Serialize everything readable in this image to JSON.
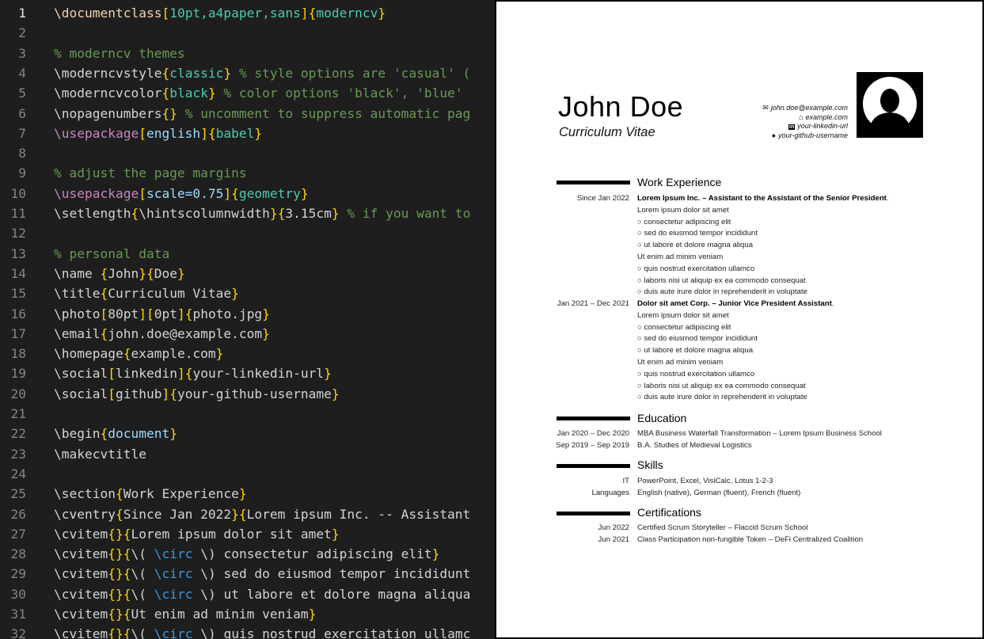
{
  "editor": {
    "lines": [
      {
        "n": "1",
        "active": true,
        "tokens": [
          [
            "tok-cmd",
            "\\documentclass"
          ],
          [
            "tok-brk",
            "["
          ],
          [
            "tok-opt",
            "10pt,a4paper,sans"
          ],
          [
            "tok-brk",
            "]"
          ],
          [
            "tok-brace",
            "{"
          ],
          [
            "tok-opt",
            "moderncv"
          ],
          [
            "tok-brace",
            "}"
          ]
        ]
      },
      {
        "n": "2",
        "tokens": []
      },
      {
        "n": "3",
        "tokens": [
          [
            "tok-com",
            "% moderncv themes"
          ]
        ]
      },
      {
        "n": "4",
        "tokens": [
          [
            "tok-txt",
            "\\moderncvstyle"
          ],
          [
            "tok-brace",
            "{"
          ],
          [
            "tok-opt",
            "classic"
          ],
          [
            "tok-brace",
            "}"
          ],
          [
            "tok-com",
            " % style options are 'casual' ("
          ]
        ]
      },
      {
        "n": "5",
        "tokens": [
          [
            "tok-txt",
            "\\moderncvcolor"
          ],
          [
            "tok-brace",
            "{"
          ],
          [
            "tok-opt",
            "black"
          ],
          [
            "tok-brace",
            "}"
          ],
          [
            "tok-com",
            " % color options 'black', 'blue'"
          ]
        ]
      },
      {
        "n": "6",
        "tokens": [
          [
            "tok-txt",
            "\\nopagenumbers"
          ],
          [
            "tok-brace",
            "{}"
          ],
          [
            "tok-com",
            " % uncomment to suppress automatic pag"
          ]
        ]
      },
      {
        "n": "7",
        "tokens": [
          [
            "tok-cmdk",
            "\\usepackage"
          ],
          [
            "tok-brk",
            "["
          ],
          [
            "tok-arg",
            "english"
          ],
          [
            "tok-brk",
            "]"
          ],
          [
            "tok-brace",
            "{"
          ],
          [
            "tok-opt",
            "babel"
          ],
          [
            "tok-brace",
            "}"
          ]
        ]
      },
      {
        "n": "8",
        "tokens": []
      },
      {
        "n": "9",
        "tokens": [
          [
            "tok-com",
            "% adjust the page margins"
          ]
        ]
      },
      {
        "n": "10",
        "tokens": [
          [
            "tok-cmdk",
            "\\usepackage"
          ],
          [
            "tok-brk",
            "["
          ],
          [
            "tok-arg",
            "scale=0.75"
          ],
          [
            "tok-brk",
            "]"
          ],
          [
            "tok-brace",
            "{"
          ],
          [
            "tok-opt",
            "geometry"
          ],
          [
            "tok-brace",
            "}"
          ]
        ]
      },
      {
        "n": "11",
        "tokens": [
          [
            "tok-txt",
            "\\setlength"
          ],
          [
            "tok-brace",
            "{"
          ],
          [
            "tok-txt",
            "\\hintscolumnwidth"
          ],
          [
            "tok-brace",
            "}{"
          ],
          [
            "tok-txt",
            "3.15cm"
          ],
          [
            "tok-brace",
            "}"
          ],
          [
            "tok-com",
            " % if you want to"
          ]
        ]
      },
      {
        "n": "12",
        "tokens": []
      },
      {
        "n": "13",
        "tokens": [
          [
            "tok-com",
            "% personal data"
          ]
        ]
      },
      {
        "n": "14",
        "tokens": [
          [
            "tok-txt",
            "\\name "
          ],
          [
            "tok-brace",
            "{"
          ],
          [
            "tok-txt",
            "John"
          ],
          [
            "tok-brace",
            "}{"
          ],
          [
            "tok-txt",
            "Doe"
          ],
          [
            "tok-brace",
            "}"
          ]
        ]
      },
      {
        "n": "15",
        "tokens": [
          [
            "tok-txt",
            "\\title"
          ],
          [
            "tok-brace",
            "{"
          ],
          [
            "tok-txt",
            "Curriculum Vitae"
          ],
          [
            "tok-brace",
            "}"
          ]
        ]
      },
      {
        "n": "16",
        "tokens": [
          [
            "tok-txt",
            "\\photo"
          ],
          [
            "tok-brk",
            "["
          ],
          [
            "tok-txt",
            "80pt"
          ],
          [
            "tok-brk",
            "]["
          ],
          [
            "tok-txt",
            "0pt"
          ],
          [
            "tok-brk",
            "]"
          ],
          [
            "tok-brace",
            "{"
          ],
          [
            "tok-txt",
            "photo.jpg"
          ],
          [
            "tok-brace",
            "}"
          ]
        ]
      },
      {
        "n": "17",
        "tokens": [
          [
            "tok-txt",
            "\\email"
          ],
          [
            "tok-brace",
            "{"
          ],
          [
            "tok-txt",
            "john.doe@example.com"
          ],
          [
            "tok-brace",
            "}"
          ]
        ]
      },
      {
        "n": "18",
        "tokens": [
          [
            "tok-txt",
            "\\homepage"
          ],
          [
            "tok-brace",
            "{"
          ],
          [
            "tok-txt",
            "example.com"
          ],
          [
            "tok-brace",
            "}"
          ]
        ]
      },
      {
        "n": "19",
        "tokens": [
          [
            "tok-txt",
            "\\social"
          ],
          [
            "tok-brk",
            "["
          ],
          [
            "tok-txt",
            "linkedin"
          ],
          [
            "tok-brk",
            "]"
          ],
          [
            "tok-brace",
            "{"
          ],
          [
            "tok-txt",
            "your-linkedin-url"
          ],
          [
            "tok-brace",
            "}"
          ]
        ]
      },
      {
        "n": "20",
        "tokens": [
          [
            "tok-txt",
            "\\social"
          ],
          [
            "tok-brk",
            "["
          ],
          [
            "tok-txt",
            "github"
          ],
          [
            "tok-brk",
            "]"
          ],
          [
            "tok-brace",
            "{"
          ],
          [
            "tok-txt",
            "your-github-username"
          ],
          [
            "tok-brace",
            "}"
          ]
        ]
      },
      {
        "n": "21",
        "tokens": []
      },
      {
        "n": "22",
        "tokens": [
          [
            "tok-txt",
            "\\begin"
          ],
          [
            "tok-brace",
            "{"
          ],
          [
            "tok-arg",
            "document"
          ],
          [
            "tok-brace",
            "}"
          ]
        ]
      },
      {
        "n": "23",
        "tokens": [
          [
            "tok-txt",
            "\\makecvtitle"
          ]
        ]
      },
      {
        "n": "24",
        "tokens": []
      },
      {
        "n": "25",
        "tokens": [
          [
            "tok-txt",
            "\\section"
          ],
          [
            "tok-brace",
            "{"
          ],
          [
            "tok-txt",
            "Work Experience"
          ],
          [
            "tok-brace",
            "}"
          ]
        ]
      },
      {
        "n": "26",
        "tokens": [
          [
            "tok-txt",
            "\\cventry"
          ],
          [
            "tok-brace",
            "{"
          ],
          [
            "tok-txt",
            "Since Jan 2022"
          ],
          [
            "tok-brace",
            "}{"
          ],
          [
            "tok-txt",
            "Lorem ipsum Inc. -- Assistant"
          ]
        ]
      },
      {
        "n": "27",
        "tokens": [
          [
            "tok-txt",
            "\\cvitem"
          ],
          [
            "tok-brace",
            "{}{"
          ],
          [
            "tok-txt",
            "Lorem ipsum dolor sit amet"
          ],
          [
            "tok-brace",
            "}"
          ]
        ]
      },
      {
        "n": "28",
        "tokens": [
          [
            "tok-txt",
            "\\cvitem"
          ],
          [
            "tok-brace",
            "{}{"
          ],
          [
            "tok-txt",
            "\\( "
          ],
          [
            "tok-math",
            "\\circ"
          ],
          [
            "tok-txt",
            " \\) consectetur adipiscing elit"
          ],
          [
            "tok-brace",
            "}"
          ]
        ]
      },
      {
        "n": "29",
        "tokens": [
          [
            "tok-txt",
            "\\cvitem"
          ],
          [
            "tok-brace",
            "{}{"
          ],
          [
            "tok-txt",
            "\\( "
          ],
          [
            "tok-math",
            "\\circ"
          ],
          [
            "tok-txt",
            " \\) sed do eiusmod tempor incididunt"
          ]
        ]
      },
      {
        "n": "30",
        "tokens": [
          [
            "tok-txt",
            "\\cvitem"
          ],
          [
            "tok-brace",
            "{}{"
          ],
          [
            "tok-txt",
            "\\( "
          ],
          [
            "tok-math",
            "\\circ"
          ],
          [
            "tok-txt",
            " \\) ut labore et dolore magna aliqua"
          ]
        ]
      },
      {
        "n": "31",
        "tokens": [
          [
            "tok-txt",
            "\\cvitem"
          ],
          [
            "tok-brace",
            "{}{"
          ],
          [
            "tok-txt",
            "Ut enim ad minim veniam"
          ],
          [
            "tok-brace",
            "}"
          ]
        ]
      },
      {
        "n": "32",
        "tokens": [
          [
            "tok-txt",
            "\\cvitem"
          ],
          [
            "tok-brace",
            "{}{"
          ],
          [
            "tok-txt",
            "\\( "
          ],
          [
            "tok-math",
            "\\circ"
          ],
          [
            "tok-txt",
            " \\) quis nostrud exercitation ullamc"
          ]
        ]
      }
    ]
  },
  "cv": {
    "name": "John Doe",
    "title": "Curriculum Vitae",
    "contacts": [
      {
        "icon": "email-icon",
        "glyph": "✉",
        "text": "john.doe@example.com"
      },
      {
        "icon": "homepage-icon",
        "glyph": "⌂",
        "text": "example.com"
      },
      {
        "icon": "linkedin-icon",
        "glyph": "in",
        "text": "your-linkedin-url"
      },
      {
        "icon": "github-icon",
        "glyph": "●",
        "text": "your-github-username"
      }
    ],
    "work": {
      "title": "Work Experience",
      "entry1": {
        "date": "Since Jan 2022",
        "heading": "Lorem Ipsum Inc. – Assistant to the Assistant of the Senior President",
        "items": [
          "Lorem ipsum dolor sit amet",
          "○ consectetur adipiscing elit",
          "○ sed do eiusmod tempor incididunt",
          "○ ut labore et dolore magna aliqua",
          "Ut enim ad minim veniam",
          "○ quis nostrud exercitation ullamco",
          "○ laboris nisi ut aliquip ex ea commodo consequat",
          "○ duis aute irure dolor in reprehenderit in voluptate"
        ]
      },
      "entry2": {
        "date": "Jan 2021 – Dec 2021",
        "heading": "Dolor sit amet Corp. – Junior Vice President Assistant",
        "items": [
          "Lorem ipsum dolor sit amet",
          "○ consectetur adipiscing elit",
          "○ sed do eiusmod tempor incididunt",
          "○ ut labore et dolore magna aliqua",
          "Ut enim ad minim veniam",
          "○ quis nostrud exercitation ullamco",
          "○ laboris nisi ut aliquip ex ea commodo consequat",
          "○ duis aute irure dolor in reprehenderit in voluptate"
        ]
      }
    },
    "education": {
      "title": "Education",
      "rows": [
        {
          "date": "Jan 2020 – Dec 2020",
          "text": "MBA Business Waterfall Transformation – Lorem Ipsum Business School"
        },
        {
          "date": "Sep 2019 – Sep 2019",
          "text": "B.A. Studies of Medieval Logistics"
        }
      ]
    },
    "skills": {
      "title": "Skills",
      "rows": [
        {
          "date": "IT",
          "text": "PowerPoint, Excel, VisiCalc, Lotus 1-2-3"
        },
        {
          "date": "Languages",
          "text": "English (native), German (fluent), French (fluent)"
        }
      ]
    },
    "certifications": {
      "title": "Certifications",
      "rows": [
        {
          "date": "Jun 2022",
          "text": "Certified Scrum Storyteller – Flaccid Scrum School"
        },
        {
          "date": "Jun 2021",
          "text": "Class Participation non-fungible Token – DeFi Centralized Coalition"
        }
      ]
    }
  }
}
